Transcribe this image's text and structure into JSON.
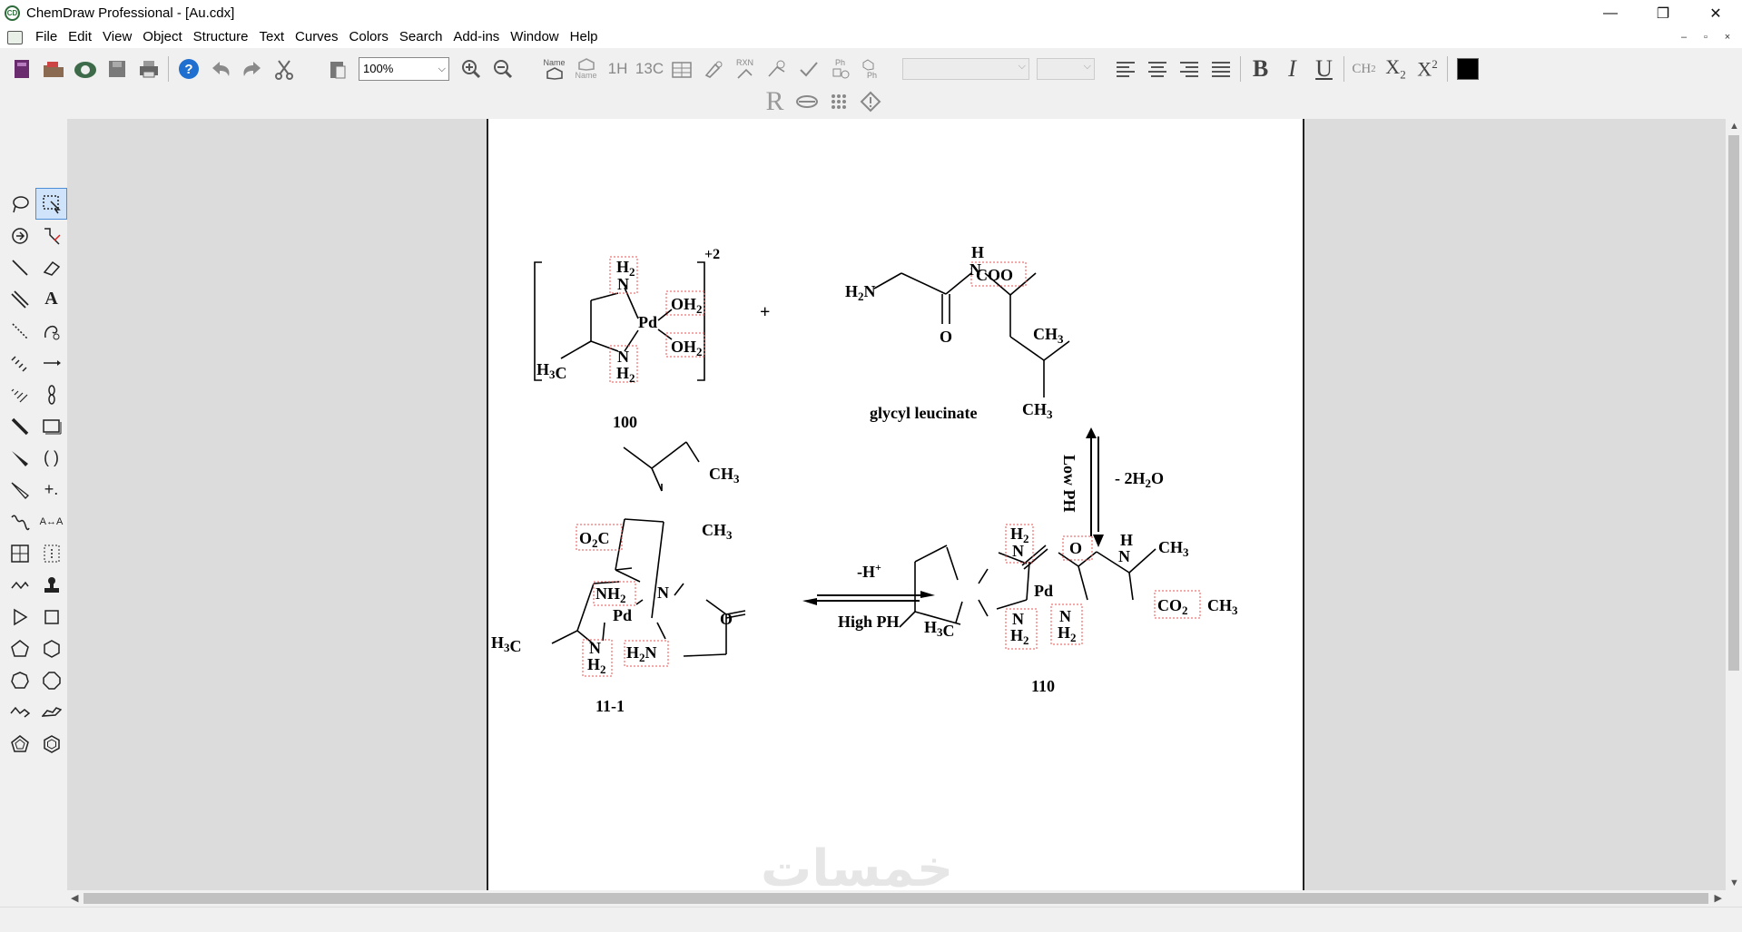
{
  "window": {
    "title": "ChemDraw Professional - [Au.cdx]",
    "controls": [
      "—",
      "❐",
      "✕"
    ]
  },
  "menu": {
    "items": [
      "File",
      "Edit",
      "View",
      "Object",
      "Structure",
      "Text",
      "Curves",
      "Colors",
      "Search",
      "Add-ins",
      "Window",
      "Help"
    ],
    "mdi_controls": [
      "–",
      "▫",
      "×"
    ]
  },
  "toolbar": {
    "zoom_value": "100%",
    "labels": {
      "name_to_struct": "Name",
      "struct_to_name": "Name",
      "h1": "1H",
      "c13": "13C",
      "rxn": "RXN",
      "ph": "Ph",
      "ch2": "CH2",
      "bold": "B",
      "italic": "I",
      "underline": "U",
      "subscript": "X2",
      "superscript": "X2"
    },
    "icons": [
      "new-document-icon",
      "open-icon",
      "chemdraw-online-icon",
      "save-icon",
      "print-icon",
      "help-icon",
      "undo-icon",
      "redo-icon",
      "cut-icon",
      "paste-icon",
      "zoom-in-icon",
      "zoom-out-icon"
    ],
    "row2_icons": [
      "r-group-icon",
      "biopolymer-icon",
      "dots-icon",
      "warning-icon"
    ],
    "color_swatch": "#000000"
  },
  "palette": {
    "icons": [
      "lasso-icon",
      "marquee-icon",
      "atom-map-icon",
      "chain-icon",
      "bond-icon",
      "eraser-icon",
      "multiple-bond-icon",
      "text-icon",
      "dashed-bond-icon",
      "pen-icon",
      "hashed-bond-icon",
      "arrow-icon",
      "hashed-wedge-icon",
      "orbital-icon",
      "bold-bond-icon",
      "rectangle-icon",
      "wedge-bond-icon",
      "brackets-icon",
      "hollow-wedge-icon",
      "charge-icon",
      "wavy-bond-icon",
      "template-icon",
      "table-icon",
      "query-icon",
      "acyclic-chain-icon",
      "stamp-icon",
      "triangle-icon",
      "square-icon",
      "pentagon-icon",
      "hexagon-icon",
      "heptagon-icon",
      "octagon-icon",
      "cyclohexane-chair-icon",
      "cyclohexane-chair2-icon",
      "cyclopentane-icon",
      "benzene-icon"
    ]
  },
  "document": {
    "charge": "+2",
    "plus": "+",
    "compound_100": "100",
    "compound_glycyl": "glycyl leucinate",
    "compound_11_1": "11-1",
    "compound_110": "110",
    "low_ph": "Low PH",
    "minus_2h2o": "- 2H2O",
    "minus_h": "-H+",
    "high_ph": "High PH"
  },
  "watermark": "خمسات"
}
